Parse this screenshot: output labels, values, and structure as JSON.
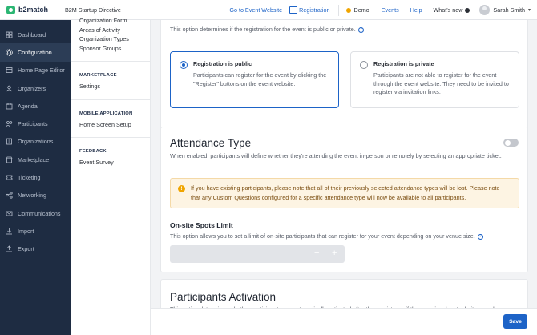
{
  "header": {
    "logo_text": "b2match",
    "event_name": "B2M Startup Directive",
    "go_to_event": "Go to Event Website",
    "registration": "Registration",
    "demo": "Demo",
    "events": "Events",
    "help": "Help",
    "whats_new": "What's new",
    "user_name": "Sarah Smith"
  },
  "sidebar": {
    "items": [
      {
        "label": "Dashboard",
        "icon": "dashboard-icon"
      },
      {
        "label": "Configuration",
        "icon": "gear-icon",
        "active": true
      },
      {
        "label": "Home Page Editor",
        "icon": "home-page-icon"
      },
      {
        "label": "Organizers",
        "icon": "organizers-icon"
      },
      {
        "label": "Agenda",
        "icon": "agenda-icon"
      },
      {
        "label": "Participants",
        "icon": "participants-icon"
      },
      {
        "label": "Organizations",
        "icon": "organizations-icon"
      },
      {
        "label": "Marketplace",
        "icon": "marketplace-icon"
      },
      {
        "label": "Ticketing",
        "icon": "ticket-icon"
      },
      {
        "label": "Networking",
        "icon": "networking-icon"
      },
      {
        "label": "Communications",
        "icon": "communications-icon"
      },
      {
        "label": "Import",
        "icon": "import-icon"
      },
      {
        "label": "Export",
        "icon": "export-icon"
      }
    ]
  },
  "subnav": {
    "top_links": [
      "Organization Form",
      "Areas of Activity",
      "Organization Types",
      "Sponsor Groups"
    ],
    "marketplace_title": "MARKETPLACE",
    "marketplace_links": [
      "Settings"
    ],
    "mobile_title": "MOBILE APPLICATION",
    "mobile_links": [
      "Home Screen Setup"
    ],
    "feedback_title": "FEEDBACK",
    "feedback_links": [
      "Event Survey"
    ]
  },
  "registration_card": {
    "description": "This option determines if the registration for the event is public or private.",
    "public_title": "Registration is public",
    "public_desc": "Participants can register for the event by clicking the \"Register\" buttons on the event website.",
    "private_title": "Registration is private",
    "private_desc": "Participants are not able to register for the event through the event website. They need to be invited to register via invitation links.",
    "selected": "public"
  },
  "attendance_card": {
    "title": "Attendance Type",
    "description": "When enabled, participants will define whether they're attending the event in-person or remotely by selecting an appropriate ticket.",
    "toggle_on": false,
    "warning": "If you have existing participants, please note that all of their previously selected attendance types will be lost. Please note that any Custom Questions configured for a specific attendance type will now be available to all participants.",
    "spots_title": "On-site Spots Limit",
    "spots_desc": "This option allows you to set a limit of on-site participants that can register for your event depending on your venue size.",
    "minus": "−",
    "plus": "+"
  },
  "activation_card": {
    "title": "Participants Activation",
    "description": "This option determines whether participants are automatically activated after they register or if the organizer has to do it manually."
  },
  "footer": {
    "save": "Save"
  },
  "colors": {
    "accent": "#1d63c7",
    "sidebar_bg": "#1e2c42",
    "warning_bg": "#fdf4e3",
    "demo_dot": "#f0a500"
  }
}
